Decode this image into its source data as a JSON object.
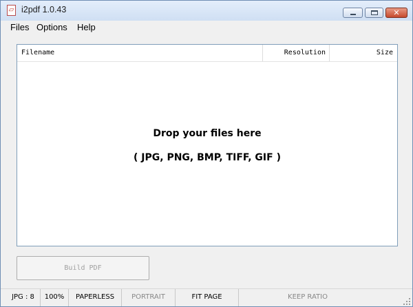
{
  "window": {
    "title": "i2pdf 1.0.43",
    "icon": "pdf-file-icon",
    "controls": {
      "minimize": "minimize-icon",
      "maximize": "maximize-icon",
      "close": "close-icon"
    }
  },
  "menu": [
    "Files",
    "Options",
    "Help"
  ],
  "file_list": {
    "columns": [
      "Filename",
      "Resolution",
      "Size"
    ],
    "drop_title": "Drop your files here",
    "drop_formats": "( JPG, PNG, BMP, TIFF, GIF )"
  },
  "build_button": {
    "label": "Build PDF"
  },
  "status": [
    {
      "label": "JPG : 8",
      "enabled": true
    },
    {
      "label": "100%",
      "enabled": true
    },
    {
      "label": "PAPERLESS",
      "enabled": true
    },
    {
      "label": "PORTRAIT",
      "enabled": false
    },
    {
      "label": "FIT PAGE",
      "enabled": true
    },
    {
      "label": "KEEP RATIO",
      "enabled": false
    }
  ]
}
